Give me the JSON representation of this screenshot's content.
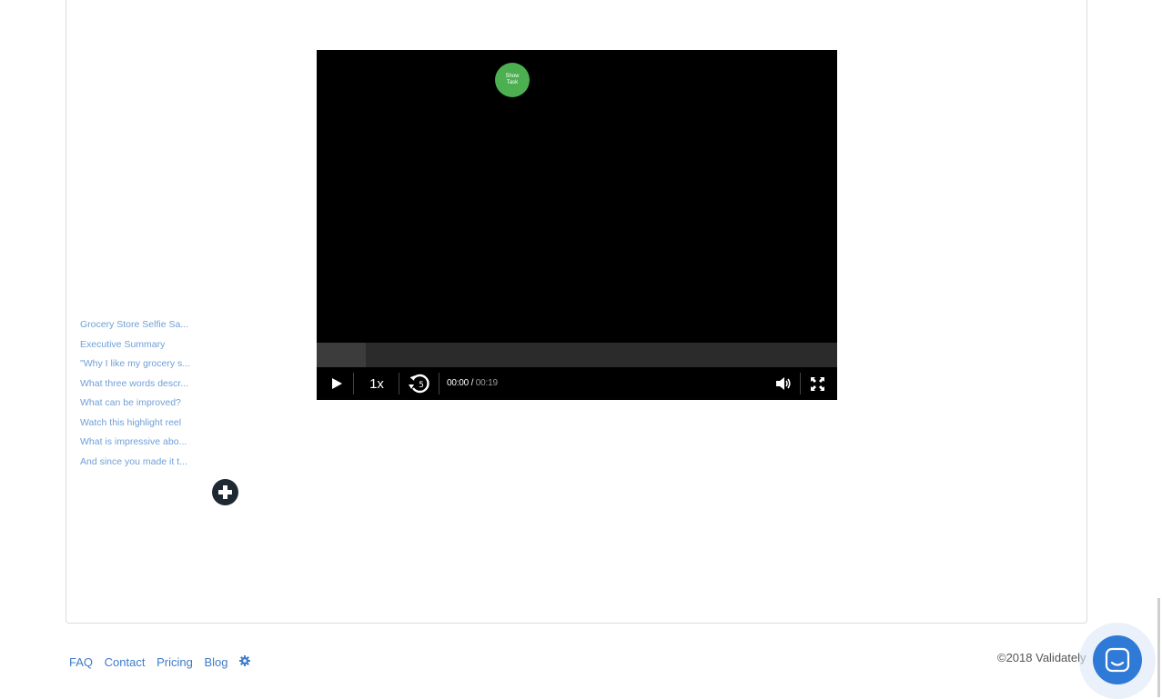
{
  "sidebar": {
    "items": [
      {
        "label": "Grocery Store Selfie Sa..."
      },
      {
        "label": "Executive Summary"
      },
      {
        "label": "\"Why I like my grocery s..."
      },
      {
        "label": "What three words descr..."
      },
      {
        "label": "What can be improved?"
      },
      {
        "label": "Watch this highlight reel"
      },
      {
        "label": "What is impressive abo..."
      },
      {
        "label": "And since you made it t..."
      }
    ],
    "add_icon": "plus-circle-icon"
  },
  "player": {
    "show_task_label": "Show Task",
    "speed": "1x",
    "rewind_seconds": "5",
    "current_time": "00:00",
    "time_separator": " / ",
    "duration": "00:19",
    "progress_fraction": 0,
    "buffered_fraction": 0.094,
    "show_task_color": "#4caf50"
  },
  "footer": {
    "links": [
      "FAQ",
      "Contact",
      "Pricing",
      "Blog"
    ],
    "settings_icon": "gear-icon",
    "copyright": "©2018 Validately"
  },
  "chat": {
    "icon": "chat-icon",
    "color": "#2f7ad6"
  },
  "colors": {
    "link": "#3d7cc9",
    "sidebar_link": "#6f9fd8"
  }
}
